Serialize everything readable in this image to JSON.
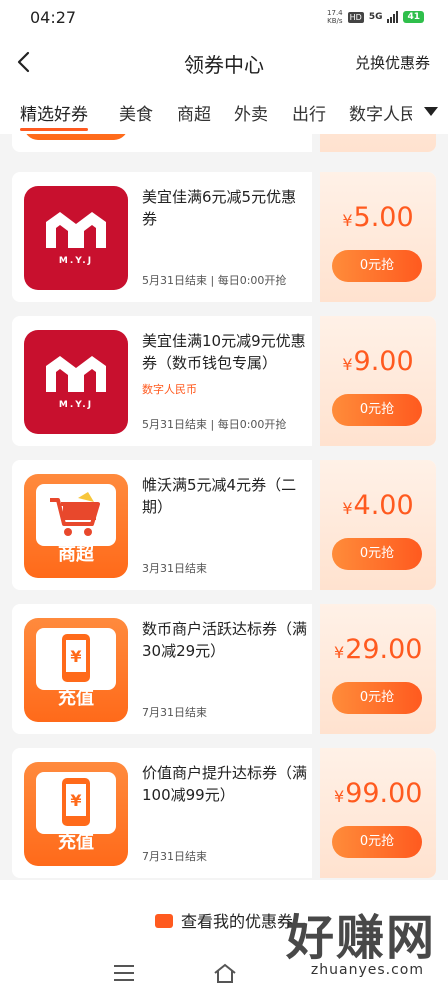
{
  "status_bar": {
    "time": "04:27",
    "net_speed_value": "17.4",
    "net_speed_unit": "KB/s",
    "hd": "HD",
    "network": "5G",
    "battery": "41"
  },
  "header": {
    "title": "领券中心",
    "exchange_label": "兑换优惠券"
  },
  "tabs": [
    {
      "label": "精选好券",
      "active": true
    },
    {
      "label": "美食"
    },
    {
      "label": "商超"
    },
    {
      "label": "外卖"
    },
    {
      "label": "出行"
    },
    {
      "label": "数字人民币"
    }
  ],
  "coupons": [
    {
      "title": "美宜佳满6元减5元优惠券",
      "tag": "",
      "date": "5月31日结束 | 每日0:00开抢",
      "currency": "¥",
      "price": "5.00",
      "button": "0元抢",
      "logo": "myj",
      "logo_text": "M.Y.J"
    },
    {
      "title": "美宜佳满10元减9元优惠券（数币钱包专属）",
      "tag": "数字人民币",
      "date": "5月31日结束 | 每日0:00开抢",
      "currency": "¥",
      "price": "9.00",
      "button": "0元抢",
      "logo": "myj",
      "logo_text": "M.Y.J"
    },
    {
      "title": "帷沃满5元减4元券（二期）",
      "tag": "",
      "date": "3月31日结束",
      "currency": "¥",
      "price": "4.00",
      "button": "0元抢",
      "logo": "supermarket",
      "logo_label": "商超"
    },
    {
      "title": "数币商户活跃达标券（满30减29元）",
      "tag": "",
      "date": "7月31日结束",
      "currency": "¥",
      "price": "29.00",
      "button": "0元抢",
      "logo": "recharge",
      "logo_label": "充值"
    },
    {
      "title": "价值商户提升达标券（满100减99元）",
      "tag": "",
      "date": "7月31日结束",
      "currency": "¥",
      "price": "99.00",
      "button": "0元抢",
      "logo": "recharge",
      "logo_label": "充值"
    }
  ],
  "bottom": {
    "my_coupons_label": "查看我的优惠券",
    "watermark": "好赚网",
    "watermark_url": "zhuanyes.com"
  },
  "colors": {
    "accent": "#ff5a1f",
    "myj_red": "#c8102e"
  }
}
